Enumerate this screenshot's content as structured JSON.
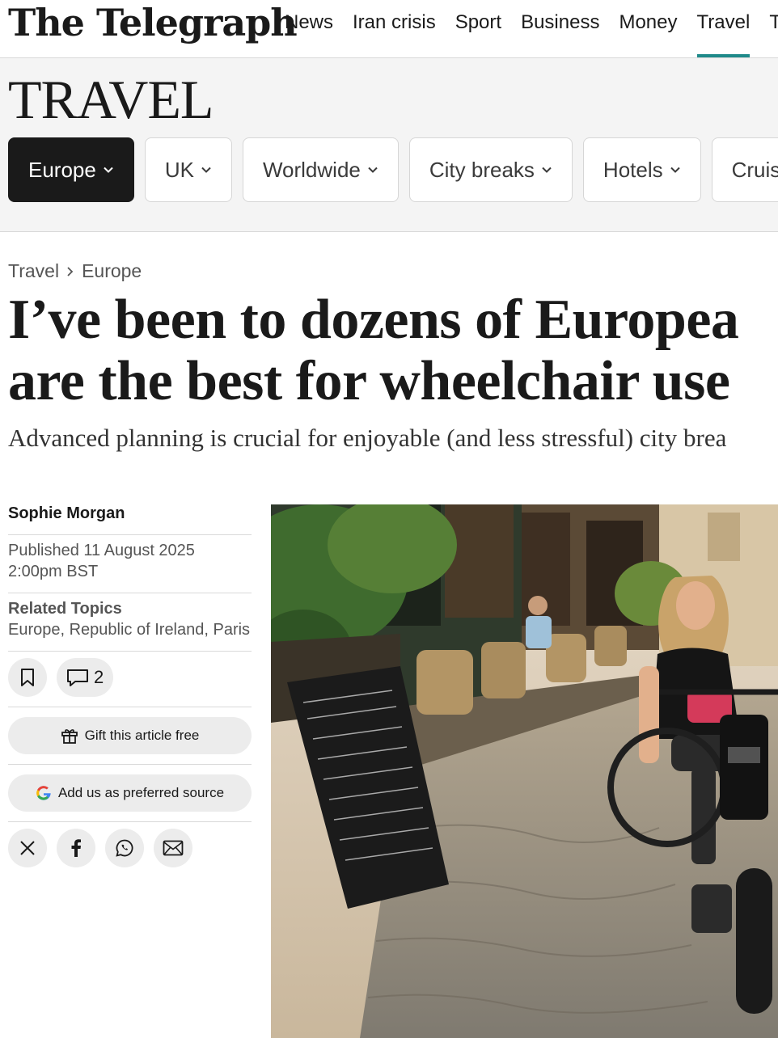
{
  "masthead": {
    "logo": "The Telegraph",
    "nav": [
      "News",
      "Iran crisis",
      "Sport",
      "Business",
      "Money",
      "Travel",
      "T"
    ],
    "active_nav": "Travel"
  },
  "section": {
    "title": "TRAVEL",
    "pills": [
      "Europe",
      "UK",
      "Worldwide",
      "City breaks",
      "Hotels",
      "Cruis"
    ],
    "active_pill": "Europe"
  },
  "breadcrumb": {
    "items": [
      "Travel",
      "Europe"
    ]
  },
  "article": {
    "headline_line1": "I’ve been to dozens of Europea",
    "headline_line2": "are the best for wheelchair use",
    "standfirst": "Advanced planning is crucial for enjoyable (and less stressful) city brea"
  },
  "meta": {
    "author": "Sophie Morgan",
    "published_line1": "Published 11 August 2025",
    "published_line2": "2:00pm BST",
    "related_label": "Related Topics",
    "related_topics": "Europe, Republic of Ireland, Paris",
    "comment_count": "2",
    "gift_label": "Gift this article free",
    "preferred_source_label": "Add us as preferred source"
  },
  "icons": {
    "bookmark": "bookmark-icon",
    "comment": "comment-icon",
    "gift": "gift-icon",
    "google": "google-icon",
    "x": "x-icon",
    "facebook": "facebook-icon",
    "whatsapp": "whatsapp-icon",
    "email": "email-icon"
  },
  "colors": {
    "accent": "#1f8a8a",
    "active_pill": "#1a1a1a",
    "section_bg": "#f4f4f4"
  }
}
